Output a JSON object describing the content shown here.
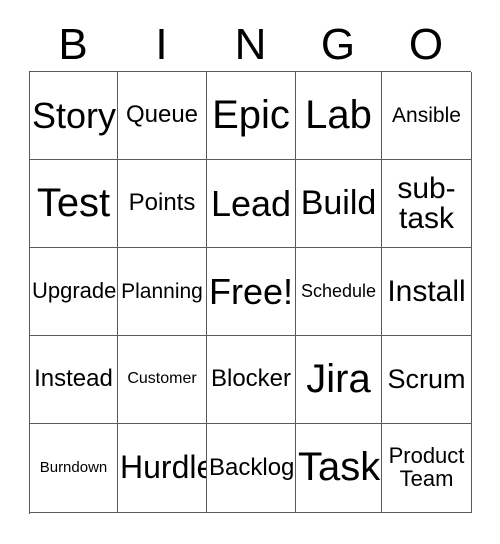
{
  "card": {
    "header_letters": [
      "B",
      "I",
      "N",
      "G",
      "O"
    ],
    "rows": [
      [
        {
          "label": "Story",
          "size": "fs-36"
        },
        {
          "label": "Queue",
          "size": "fs-24"
        },
        {
          "label": "Epic",
          "size": "fs-40"
        },
        {
          "label": "Lab",
          "size": "fs-40"
        },
        {
          "label": "Ansible",
          "size": "fs-21"
        }
      ],
      [
        {
          "label": "Test",
          "size": "fs-40"
        },
        {
          "label": "Points",
          "size": "fs-24"
        },
        {
          "label": "Lead",
          "size": "fs-36"
        },
        {
          "label": "Build",
          "size": "fs-34"
        },
        {
          "label": "sub-\ntask",
          "size": "fs-30-2"
        }
      ],
      [
        {
          "label": "Upgrade",
          "size": "fs-22"
        },
        {
          "label": "Planning",
          "size": "fs-21"
        },
        {
          "label": "Free!",
          "size": "fs-36"
        },
        {
          "label": "Schedule",
          "size": "fs-18"
        },
        {
          "label": "Install",
          "size": "fs-30"
        }
      ],
      [
        {
          "label": "Instead",
          "size": "fs-24"
        },
        {
          "label": "Customer",
          "size": "fs-16"
        },
        {
          "label": "Blocker",
          "size": "fs-24"
        },
        {
          "label": "Jira",
          "size": "fs-40"
        },
        {
          "label": "Scrum",
          "size": "fs-27"
        }
      ],
      [
        {
          "label": "Burndown",
          "size": "fs-15"
        },
        {
          "label": "Hurdle",
          "size": "fs-32"
        },
        {
          "label": "Backlog",
          "size": "fs-24"
        },
        {
          "label": "Task",
          "size": "fs-40"
        },
        {
          "label": "Product\nTeam",
          "size": "fs-22"
        }
      ]
    ],
    "free_space": "Free!",
    "colors": {
      "grid_line": "#555b5e",
      "cell_background": "#ffffff",
      "text": "#000000",
      "page_background": "#ffffff"
    }
  }
}
